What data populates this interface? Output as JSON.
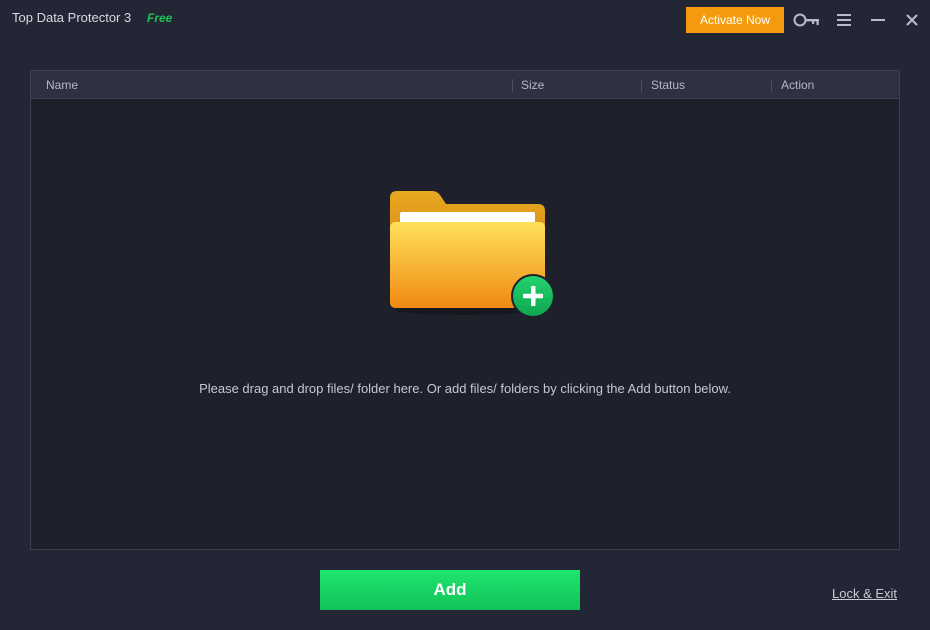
{
  "titlebar": {
    "app_title": "Top Data Protector 3",
    "badge": "Free",
    "activate_label": "Activate Now",
    "icons": [
      "key-icon",
      "menu-icon",
      "minimize-icon",
      "close-icon"
    ]
  },
  "table": {
    "columns": [
      "Name",
      "Size",
      "Status",
      "Action"
    ],
    "rows": [],
    "empty_hint": "Please drag and drop files/ folder here. Or add files/ folders by clicking the Add button below.",
    "empty_icon": "folder-add-icon"
  },
  "footer": {
    "add_label": "Add",
    "lock_exit_label": "Lock & Exit"
  },
  "colors": {
    "background": "#232634",
    "accent_orange": "#f59a0c",
    "accent_green": "#1ee56f",
    "free_badge": "#1ec25c"
  }
}
